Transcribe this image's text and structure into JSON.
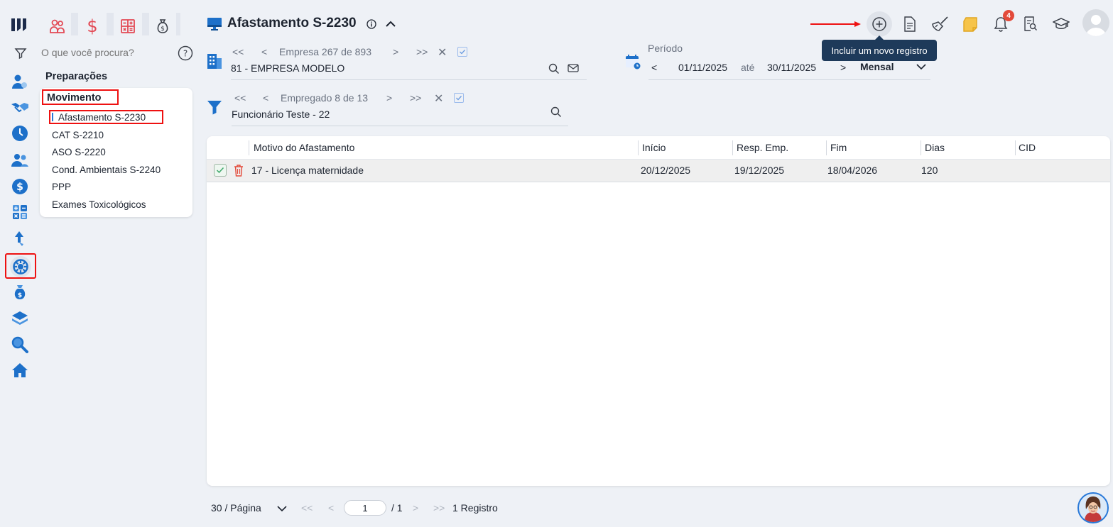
{
  "search": {
    "placeholder": "O que você procura?"
  },
  "menu": {
    "section_title": "Preparações",
    "group_title": "Movimento",
    "items": [
      "Afastamento S-2230",
      "CAT S-2210",
      "ASO S-2220",
      "Cond. Ambientais S-2240",
      "PPP",
      "Exames Toxicológicos"
    ]
  },
  "header": {
    "title": "Afastamento S-2230"
  },
  "empresa": {
    "label": "Empresa",
    "position": "267",
    "of_label": "de",
    "total": "893",
    "value": "81 - EMPRESA MODELO"
  },
  "empregado": {
    "label": "Empregado",
    "position": "8",
    "of_label": "de",
    "total": "13",
    "value": "Funcionário Teste - 22"
  },
  "periodo": {
    "label": "Período",
    "start": "01/11/2025",
    "until_label": "até",
    "end": "30/11/2025",
    "mode": "Mensal"
  },
  "toolbar": {
    "tooltip": "Incluir um novo registro",
    "notification_count": "4"
  },
  "grid": {
    "columns": [
      "Motivo do Afastamento",
      "Início",
      "Resp. Emp.",
      "Fim",
      "Dias",
      "CID"
    ],
    "rows": [
      {
        "motivo": "17 - Licença maternidade",
        "inicio": "20/12/2025",
        "resp": "19/12/2025",
        "fim": "18/04/2026",
        "dias": "120",
        "cid": ""
      }
    ]
  },
  "pagination": {
    "per_page": "30 / Página",
    "current": "1",
    "total_pages": "/ 1",
    "records": "1 Registro"
  },
  "colors": {
    "accent": "#2878d8",
    "highlight": "#e11111",
    "danger": "#e34a3a",
    "tooltip": "#1e3a5a"
  }
}
